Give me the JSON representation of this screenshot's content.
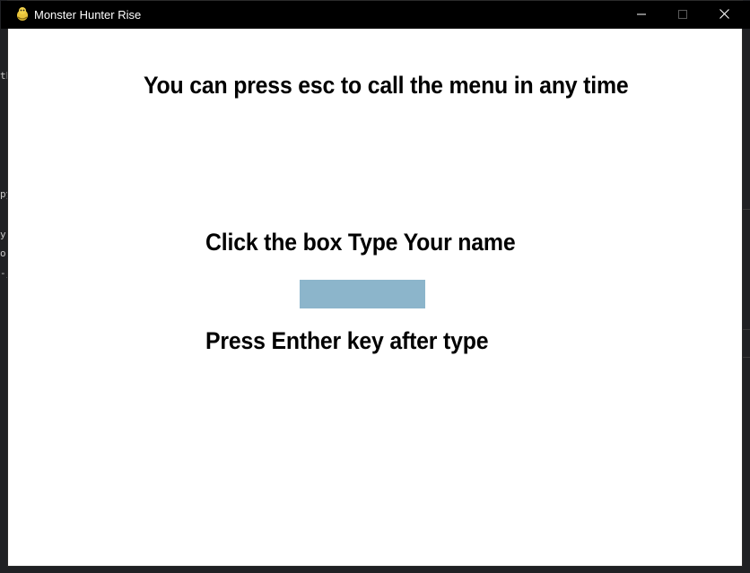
{
  "window": {
    "title": "Monster Hunter Rise",
    "controls": {
      "minimize_icon": "minimize-icon",
      "maximize_icon": "maximize-icon",
      "close_icon": "close-icon"
    }
  },
  "background_fragments": [
    "th",
    "py",
    "y",
    "or",
    "-j"
  ],
  "screen": {
    "hint": "You can press esc to call the menu in any time",
    "prompt": "Click the box Type Your name",
    "name_input_value": "",
    "after_prompt": "Press Enther key after type"
  },
  "colors": {
    "titlebar": "#000000",
    "client_bg": "#ffffff",
    "input_box": "#8cb5cb",
    "text": "#000000"
  }
}
